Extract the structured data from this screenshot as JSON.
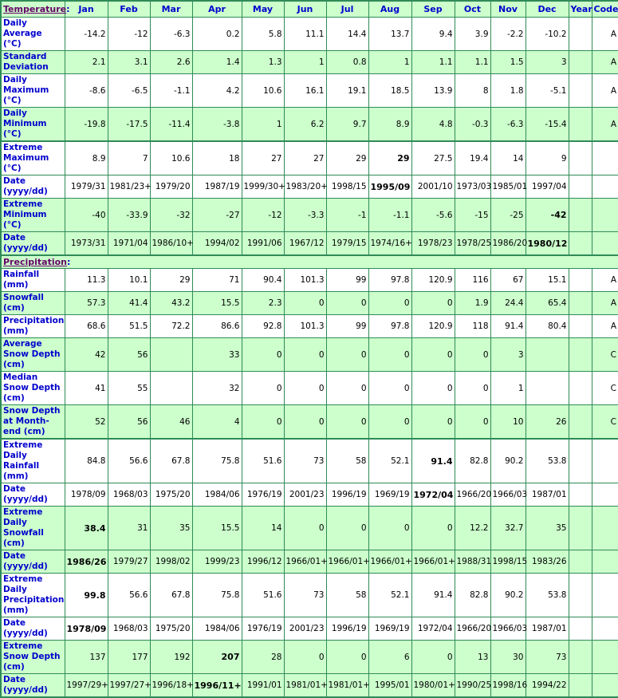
{
  "header": {
    "section_label": "Temperature",
    "months": [
      "Jan",
      "Feb",
      "Mar",
      "Apr",
      "May",
      "Jun",
      "Jul",
      "Aug",
      "Sep",
      "Oct",
      "Nov",
      "Dec"
    ],
    "year_label": "Year",
    "code_label": "Code"
  },
  "temperature": {
    "rows": [
      {
        "label": "Daily Average (°C)",
        "values": [
          "-14.2",
          "-12",
          "-6.3",
          "0.2",
          "5.8",
          "11.1",
          "14.4",
          "13.7",
          "9.4",
          "3.9",
          "-2.2",
          "-10.2"
        ],
        "year": "",
        "code": "A",
        "bold": []
      },
      {
        "label": "Standard Deviation",
        "values": [
          "2.1",
          "3.1",
          "2.6",
          "1.4",
          "1.3",
          "1",
          "0.8",
          "1",
          "1.1",
          "1.1",
          "1.5",
          "3"
        ],
        "year": "",
        "code": "A",
        "bold": []
      },
      {
        "label": "Daily Maximum (°C)",
        "values": [
          "-8.6",
          "-6.5",
          "-1.1",
          "4.2",
          "10.6",
          "16.1",
          "19.1",
          "18.5",
          "13.9",
          "8",
          "1.8",
          "-5.1"
        ],
        "year": "",
        "code": "A",
        "bold": []
      },
      {
        "label": "Daily Minimum (°C)",
        "values": [
          "-19.8",
          "-17.5",
          "-11.4",
          "-3.8",
          "1",
          "6.2",
          "9.7",
          "8.9",
          "4.8",
          "-0.3",
          "-6.3",
          "-15.4"
        ],
        "year": "",
        "code": "A",
        "bold": []
      },
      {
        "label": "Extreme Maximum (°C)",
        "values": [
          "8.9",
          "7",
          "10.6",
          "18",
          "27",
          "27",
          "29",
          "29",
          "27.5",
          "19.4",
          "14",
          "9"
        ],
        "year": "",
        "code": "",
        "bold": [
          7
        ]
      },
      {
        "label": "Date (yyyy/dd)",
        "values": [
          "1979/31",
          "1981/23+",
          "1979/20",
          "1987/19",
          "1999/30+",
          "1983/20+",
          "1998/15",
          "1995/09",
          "2001/10",
          "1973/03",
          "1985/01",
          "1997/04"
        ],
        "year": "",
        "code": "",
        "bold": [
          7
        ]
      },
      {
        "label": "Extreme Minimum (°C)",
        "values": [
          "-40",
          "-33.9",
          "-32",
          "-27",
          "-12",
          "-3.3",
          "-1",
          "-1.1",
          "-5.6",
          "-15",
          "-25",
          "-42"
        ],
        "year": "",
        "code": "",
        "bold": [
          11
        ]
      },
      {
        "label": "Date (yyyy/dd)",
        "values": [
          "1973/31",
          "1971/04",
          "1986/10+",
          "1994/02",
          "1991/06",
          "1967/12",
          "1979/15",
          "1974/16+",
          "1978/23",
          "1978/25",
          "1986/20",
          "1980/12"
        ],
        "year": "",
        "code": "",
        "bold": [
          11
        ]
      }
    ]
  },
  "precipitation": {
    "section_label": "Precipitation",
    "rows": [
      {
        "label": "Rainfall (mm)",
        "values": [
          "11.3",
          "10.1",
          "29",
          "71",
          "90.4",
          "101.3",
          "99",
          "97.8",
          "120.9",
          "116",
          "67",
          "15.1"
        ],
        "year": "",
        "code": "A",
        "bold": []
      },
      {
        "label": "Snowfall (cm)",
        "values": [
          "57.3",
          "41.4",
          "43.2",
          "15.5",
          "2.3",
          "0",
          "0",
          "0",
          "0",
          "1.9",
          "24.4",
          "65.4"
        ],
        "year": "",
        "code": "A",
        "bold": []
      },
      {
        "label": "Precipitation (mm)",
        "values": [
          "68.6",
          "51.5",
          "72.2",
          "86.6",
          "92.8",
          "101.3",
          "99",
          "97.8",
          "120.9",
          "118",
          "91.4",
          "80.4"
        ],
        "year": "",
        "code": "A",
        "bold": []
      },
      {
        "label": "Average Snow Depth (cm)",
        "values": [
          "42",
          "56",
          "",
          "33",
          "0",
          "0",
          "0",
          "0",
          "0",
          "0",
          "3",
          ""
        ],
        "year": "",
        "code": "C",
        "bold": []
      },
      {
        "label": "Median Snow Depth (cm)",
        "values": [
          "41",
          "55",
          "",
          "32",
          "0",
          "0",
          "0",
          "0",
          "0",
          "0",
          "1",
          ""
        ],
        "year": "",
        "code": "C",
        "bold": []
      },
      {
        "label": "Snow Depth at Month-end (cm)",
        "values": [
          "52",
          "56",
          "46",
          "4",
          "0",
          "0",
          "0",
          "0",
          "0",
          "0",
          "10",
          "26"
        ],
        "year": "",
        "code": "C",
        "bold": []
      },
      {
        "label": "Extreme Daily Rainfall (mm)",
        "values": [
          "84.8",
          "56.6",
          "67.8",
          "75.8",
          "51.6",
          "73",
          "58",
          "52.1",
          "91.4",
          "82.8",
          "90.2",
          "53.8"
        ],
        "year": "",
        "code": "",
        "bold": [
          8
        ]
      },
      {
        "label": "Date (yyyy/dd)",
        "values": [
          "1978/09",
          "1968/03",
          "1975/20",
          "1984/06",
          "1976/19",
          "2001/23",
          "1996/19",
          "1969/19",
          "1972/04",
          "1966/20",
          "1966/03",
          "1987/01"
        ],
        "year": "",
        "code": "",
        "bold": [
          8
        ]
      },
      {
        "label": "Extreme Daily Snowfall (cm)",
        "values": [
          "38.4",
          "31",
          "35",
          "15.5",
          "14",
          "0",
          "0",
          "0",
          "0",
          "12.2",
          "32.7",
          "35"
        ],
        "year": "",
        "code": "",
        "bold": [
          0
        ]
      },
      {
        "label": "Date (yyyy/dd)",
        "values": [
          "1986/26",
          "1979/27",
          "1998/02",
          "1999/23",
          "1996/12",
          "1966/01+",
          "1966/01+",
          "1966/01+",
          "1966/01+",
          "1988/31",
          "1998/15",
          "1983/26"
        ],
        "year": "",
        "code": "",
        "bold": [
          0
        ]
      },
      {
        "label": "Extreme Daily Precipitation (mm)",
        "values": [
          "99.8",
          "56.6",
          "67.8",
          "75.8",
          "51.6",
          "73",
          "58",
          "52.1",
          "91.4",
          "82.8",
          "90.2",
          "53.8"
        ],
        "year": "",
        "code": "",
        "bold": [
          0
        ]
      },
      {
        "label": "Date (yyyy/dd)",
        "values": [
          "1978/09",
          "1968/03",
          "1975/20",
          "1984/06",
          "1976/19",
          "2001/23",
          "1996/19",
          "1969/19",
          "1972/04",
          "1966/20",
          "1966/03",
          "1987/01"
        ],
        "year": "",
        "code": "",
        "bold": [
          0
        ]
      },
      {
        "label": "Extreme Snow Depth (cm)",
        "values": [
          "137",
          "177",
          "192",
          "207",
          "28",
          "0",
          "0",
          "6",
          "0",
          "13",
          "30",
          "73"
        ],
        "year": "",
        "code": "",
        "bold": [
          3
        ]
      },
      {
        "label": "Date (yyyy/dd)",
        "values": [
          "1997/29+",
          "1997/27+",
          "1996/18+",
          "1996/11+",
          "1991/01",
          "1981/01+",
          "1981/01+",
          "1995/01",
          "1980/01+",
          "1990/25",
          "1998/16",
          "1994/22"
        ],
        "year": "",
        "code": "",
        "bold": [
          3
        ]
      }
    ]
  },
  "colors": {
    "label_text": "#0000cc",
    "section_link": "#660066",
    "row_green": "#ccffcc",
    "row_white": "#ffffff",
    "border": "#2e8b57"
  }
}
